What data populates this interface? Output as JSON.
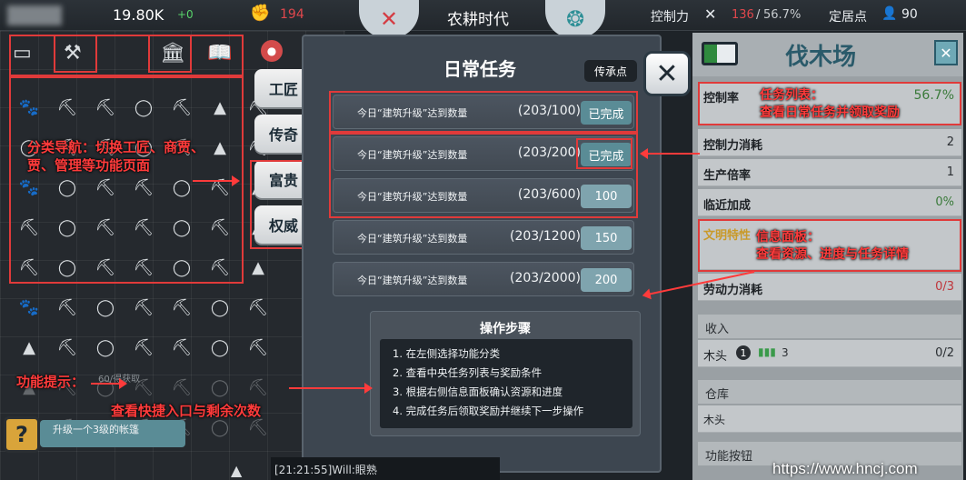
{
  "topbar": {
    "resource_value": "19.80K",
    "resource_delta": "+0",
    "resource2": "194",
    "era_title": "农耕时代",
    "control_label": "控制力",
    "control_value": "136",
    "control_pct": "56.7%",
    "settle_label": "定居点",
    "settle_value": "90"
  },
  "sidebar_tabs": [
    "工匠",
    "传奇",
    "富贵",
    "权威"
  ],
  "dialog": {
    "title": "日常任务",
    "inherit_button": "传承点",
    "close_icon": "close-icon",
    "tasks": [
      {
        "label": "今日“建筑升级”达到数量",
        "progress": "(203/100)",
        "reward": "已完成"
      },
      {
        "label": "今日“建筑升级”达到数量",
        "progress": "(203/200)",
        "reward": "已完成"
      },
      {
        "label": "今日“建筑升级”达到数量",
        "progress": "(203/600)",
        "reward": "100"
      },
      {
        "label": "今日“建筑升级”达到数量",
        "progress": "(203/1200)",
        "reward": "150"
      },
      {
        "label": "今日“建筑升级”达到数量",
        "progress": "(203/2000)",
        "reward": "200"
      }
    ]
  },
  "steps": {
    "title": "操作步骤",
    "items": [
      "1. 在左侧选择功能分类",
      "2. 查看中央任务列表与奖励条件",
      "3. 根据右侧信息面板确认资源和进度",
      "4. 完成任务后领取奖励并继续下一步操作"
    ]
  },
  "right_panel": {
    "title": "伐木场",
    "rows": [
      {
        "k": "控制率",
        "v": "56.7%"
      },
      {
        "k": "控制力消耗",
        "v": "2"
      },
      {
        "k": "生产倍率",
        "v": "1"
      },
      {
        "k": "临近加成",
        "v": "0%"
      },
      {
        "k": "文明特性",
        "v": ""
      },
      {
        "k": "劳动力消耗",
        "v": "0/3"
      }
    ],
    "income_label": "收入",
    "wood_label": "木头",
    "wood_level": "3",
    "wood_value": "0/2",
    "warehouse_label": "仓库",
    "warehouse_item": "木头",
    "func_label": "功能按钮"
  },
  "bottom": {
    "hint_button": "?",
    "upgrade_text": "升级一个3级的帐篷",
    "chat": "[21:21:55]Will:眼熟",
    "faded_count": "60/得获取"
  },
  "annotations": {
    "nav": "分类导航：切换工匠、商贾、\n贾、管理等功能页面",
    "tasks": "任务列表：\n查看日常任务并领取奖励",
    "info": "信息面板：\n查看资源、进度与任务详情",
    "hint_title": "功能提示：",
    "hint_desc": "查看快捷入口与剩余次数"
  },
  "watermark": "https://www.hncj.com"
}
